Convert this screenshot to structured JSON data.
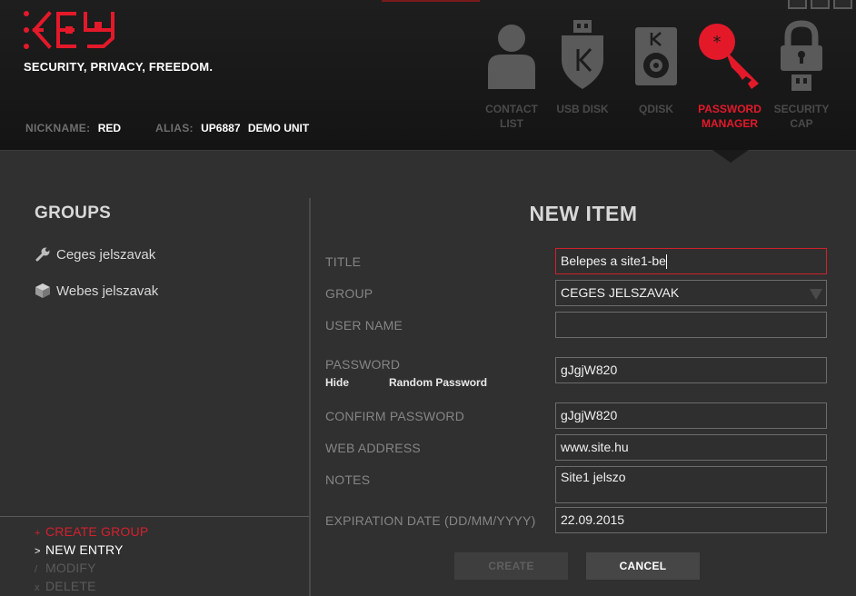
{
  "app": {
    "tagline": "SECURITY, PRIVACY, FREEDOM."
  },
  "user": {
    "nickname_label": "NICKNAME:",
    "nickname_value": "RED",
    "alias_label": "ALIAS:",
    "alias_value": "UP6887",
    "unit_value": "DEMO UNIT"
  },
  "nav": {
    "contact_list_l1": "CONTACT",
    "contact_list_l2": "LIST",
    "usb_disk_l1": "USB DISK",
    "qdisk_l1": "QDISK",
    "password_manager_l1": "PASSWORD",
    "password_manager_l2": "MANAGER",
    "security_cap_l1": "SECURITY",
    "security_cap_l2": "CAP",
    "active": "PASSWORD MANAGER",
    "accent_color": "#e3192a"
  },
  "groups": {
    "title": "GROUPS",
    "items": [
      {
        "label": "Ceges jelszavak",
        "icon": "wrench-icon"
      },
      {
        "label": "Webes jelszavak",
        "icon": "cube-icon"
      }
    ]
  },
  "actions": {
    "create_group": {
      "glyph": "+",
      "label": "CREATE GROUP"
    },
    "new_entry": {
      "glyph": ">",
      "label": "NEW ENTRY"
    },
    "modify": {
      "glyph": "/",
      "label": "MODIFY"
    },
    "delete": {
      "glyph": "x",
      "label": "DELETE"
    }
  },
  "form": {
    "title": "NEW ITEM",
    "labels": {
      "title": "TITLE",
      "group": "GROUP",
      "user_name": "USER NAME",
      "password": "PASSWORD",
      "confirm_password": "CONFIRM PASSWORD",
      "web_address": "WEB ADDRESS",
      "notes": "NOTES",
      "expiration_date": "EXPIRATION DATE (DD/MM/YYYY)"
    },
    "hide_label": "Hide",
    "random_password_label": "Random Password",
    "values": {
      "title": "Belepes a site1-be",
      "group": "CEGES JELSZAVAK",
      "user_name": "",
      "password": "gJgjW820",
      "confirm_password": "gJgjW820",
      "web_address": "www.site.hu",
      "notes": "Site1 jelszo",
      "expiration_date": "22.09.2015"
    },
    "buttons": {
      "create": "CREATE",
      "cancel": "CANCEL"
    }
  }
}
